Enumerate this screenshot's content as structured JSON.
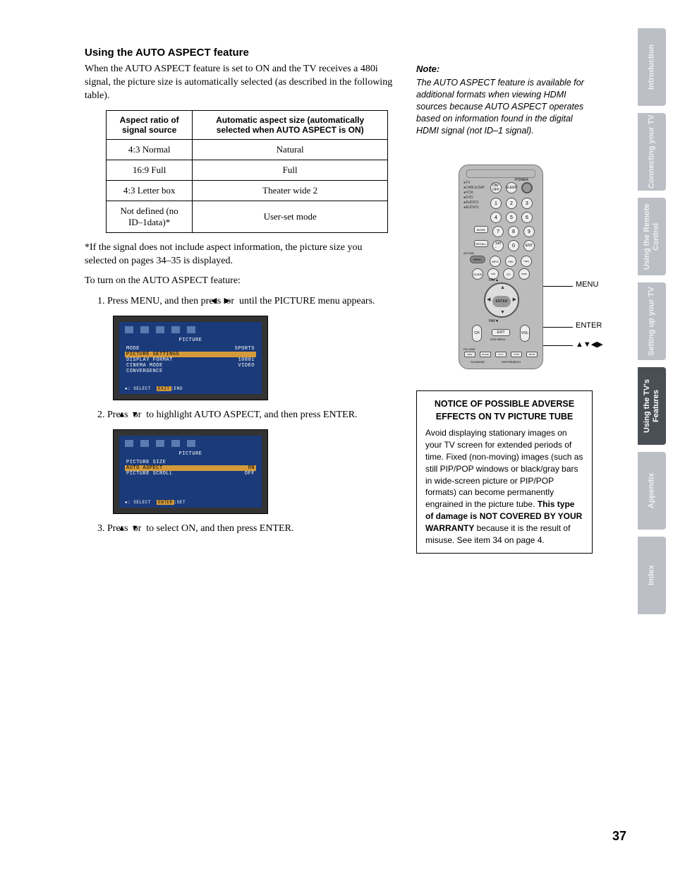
{
  "heading": "Using the AUTO ASPECT feature",
  "intro": "When the AUTO ASPECT feature is set to ON and the TV receives a 480i signal, the picture size is automatically selected (as described in the following table).",
  "table": {
    "header_left": "Aspect ratio of signal source",
    "header_right": "Automatic aspect size (automatically selected when AUTO ASPECT is ON)",
    "rows": [
      {
        "l": "4:3 Normal",
        "r": "Natural"
      },
      {
        "l": "16:9 Full",
        "r": "Full"
      },
      {
        "l": "4:3 Letter box",
        "r": "Theater wide 2"
      },
      {
        "l": "Not defined (no ID–1data)*",
        "r": "User-set mode"
      }
    ]
  },
  "footnote": "*If the signal does not include aspect information, the picture size you selected on pages 34–35 is displayed.",
  "turn_on": "To turn on the AUTO ASPECT feature:",
  "step1_a": "1.  Press MENU, and then press ",
  "step1_b": " or ",
  "step1_c": " until the PICTURE menu appears.",
  "step2_a": "2.  Press ",
  "step2_b": " or ",
  "step2_c": " to highlight AUTO ASPECT, and then press ENTER.",
  "step3_a": "3.  Press ",
  "step3_b": " or ",
  "step3_c": " to select ON, and then press ENTER.",
  "osd1": {
    "title": "PICTURE",
    "rows": [
      {
        "l": "MODE",
        "r": "SPORTS",
        "hl": false
      },
      {
        "l": "PICTURE SETTINGS",
        "r": "",
        "hl": true
      },
      {
        "l": "DISPLAY FORMAT",
        "r": "1080i",
        "hl": false
      },
      {
        "l": "CINEMA MODE",
        "r": "VIDEO",
        "hl": false
      },
      {
        "l": "CONVERGENCE",
        "r": "",
        "hl": false
      }
    ],
    "foot_select": ": SELECT",
    "foot_key": "EXIT",
    "foot_end": ":END"
  },
  "osd2": {
    "title": "PICTURE",
    "rows": [
      {
        "l": "PICTURE SIZE",
        "r": "",
        "hl": false
      },
      {
        "l": "AUTO ASPECT",
        "r": "ON",
        "hl": true
      },
      {
        "l": "PICTURE SCROLL",
        "r": "OFF",
        "hl": false
      }
    ],
    "foot_select": ": SELECT",
    "foot_key": "ENTER",
    "foot_end": ":SET"
  },
  "note": {
    "head": "Note:",
    "body": "The AUTO ASPECT feature is available for additional formats when viewing HDMI sources because AUTO ASPECT operates based on information found in the digital HDMI signal (not ID–1 signal)."
  },
  "remote": {
    "label_menu": "MENU",
    "label_enter": "ENTER",
    "label_arrows": "▲▼◀▶",
    "inputs": [
      "TV",
      "CABLE/SAT",
      "VCR",
      "DVD",
      "AUDIO1",
      "AUDIO2"
    ],
    "power": "POWER",
    "mode": "MODE",
    "recall": "RECALL",
    "action": "ACTION",
    "menu_btn": "MENU",
    "info": "INFO",
    "favorite": "FAVORITE",
    "guide": "GUIDE",
    "subtitle": "SUBTITLE",
    "theater": "THEATER",
    "cc": "CC",
    "fav_up": "FAV▲",
    "enter": "ENTER",
    "fav_down": "FAV▼",
    "ch": "CH",
    "vol": "VOL",
    "exit": "EXIT",
    "dvd_menu": "DVD MENU",
    "pic_size": "PIC SIZE",
    "bottom": [
      "REW",
      "PAUSE",
      "PLAY",
      "STOP",
      "MUTE",
      "SLOW/DIR",
      "SKIP/SEARCH"
    ]
  },
  "notice": {
    "head": "NOTICE OF POSSIBLE ADVERSE EFFECTS ON TV PICTURE TUBE",
    "body_a": "Avoid displaying stationary images on your TV screen for extended periods of time. Fixed (non-moving) images (such as still PIP/POP windows or black/gray bars in wide-screen picture or PIP/POP formats) can become permanently engrained in the picture tube. ",
    "body_b": "This type of damage is NOT COVERED BY YOUR WARRANTY",
    "body_c": " because it is the result of misuse. See item 34 on page 4."
  },
  "tabs": [
    "Introduction",
    "Connecting your TV",
    "Using the Remote Control",
    "Setting up your TV",
    "Using the TV's Features",
    "Appendix",
    "Index"
  ],
  "active_tab_index": 4,
  "page_number": "37"
}
